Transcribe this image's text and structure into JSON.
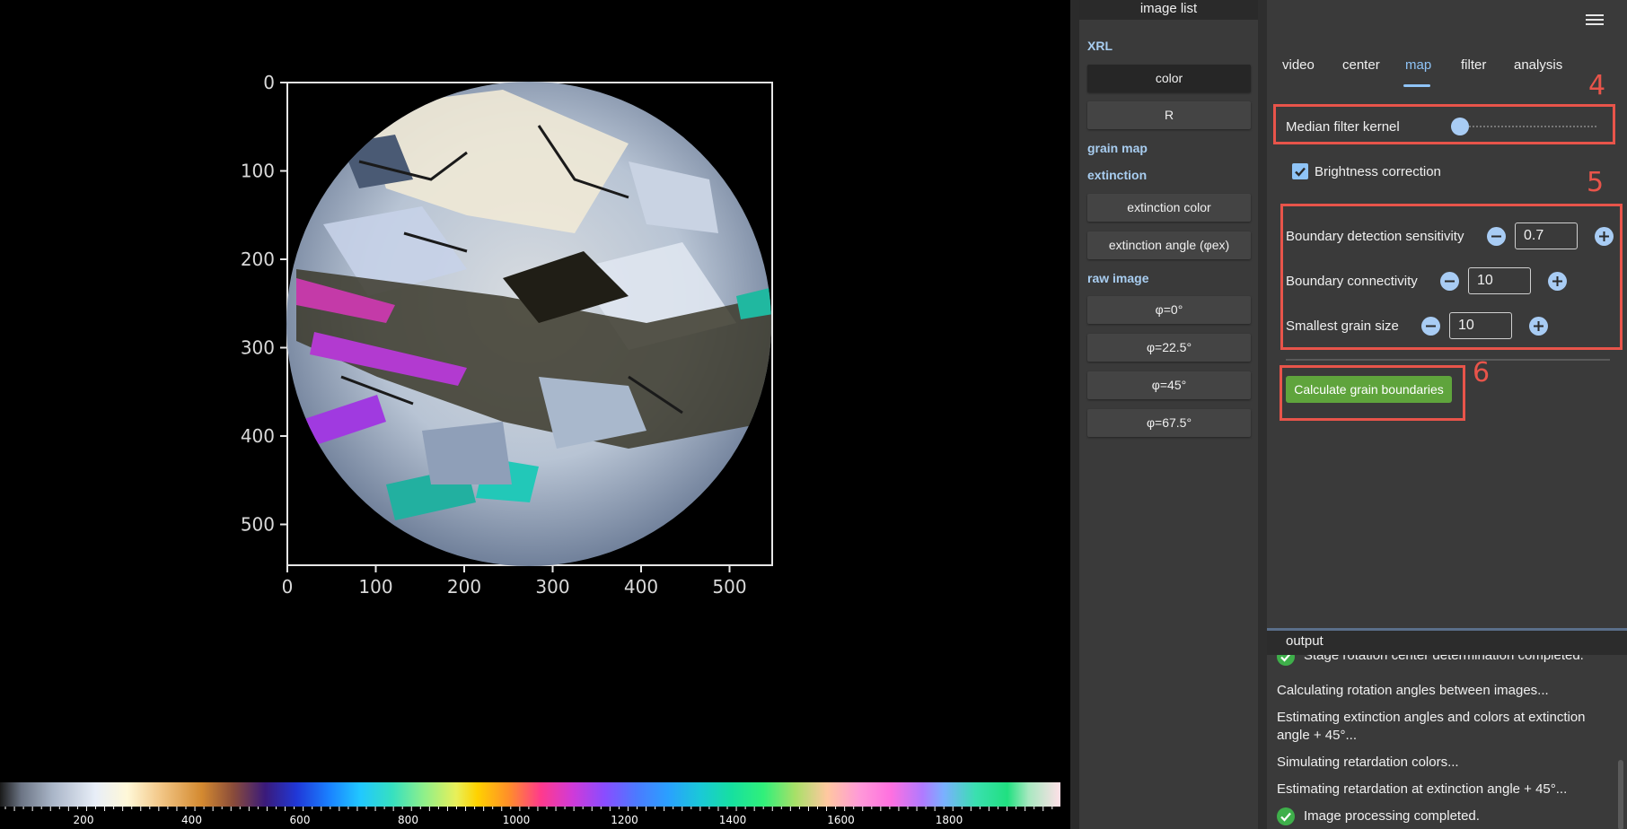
{
  "plot": {
    "x_ticks": [
      "0",
      "100",
      "200",
      "300",
      "400",
      "500"
    ],
    "y_ticks": [
      "0",
      "100",
      "200",
      "300",
      "400",
      "500"
    ],
    "colorbar_ticks": [
      "200",
      "400",
      "600",
      "800",
      "1000",
      "1200",
      "1400",
      "1600",
      "1800"
    ]
  },
  "image_list": {
    "header": "image list",
    "groups": {
      "xrl": "XRL",
      "grain_map": "grain map",
      "extinction": "extinction",
      "raw_image": "raw image"
    },
    "buttons": {
      "color": "color",
      "r": "R",
      "extinction_color": "extinction color",
      "extinction_angle": "extinction angle (φex)",
      "phi0": "φ=0°",
      "phi22": "φ=22.5°",
      "phi45": "φ=45°",
      "phi67": "φ=67.5°"
    },
    "selected": "color"
  },
  "settings": {
    "tabs": [
      "video",
      "center",
      "map",
      "filter",
      "analysis"
    ],
    "active_tab": "map",
    "median_filter_label": "Median filter kernel",
    "median_filter_level": 0,
    "brightness_label": "Brightness correction",
    "brightness_checked": true,
    "sensitivity_label": "Boundary detection sensitivity",
    "sensitivity_value": "0.7",
    "connectivity_label": "Boundary connectivity",
    "connectivity_value": "10",
    "grain_size_label": "Smallest grain size",
    "grain_size_value": "10",
    "calc_button": "Calculate grain boundaries",
    "annotations": [
      "4",
      "5",
      "6"
    ]
  },
  "output": {
    "header": "output",
    "lines": [
      "Stage rotation center determination completed.",
      "Calculating rotation angles between images...",
      "Estimating extinction angles and colors at extinction angle + 45°...",
      "Simulating retardation colors...",
      "Estimating retardation at extinction angle + 45°...",
      "Image processing completed."
    ]
  },
  "colors": {
    "accent": "#8fc4f7",
    "annotation": "#e8544a",
    "success": "#3eaf4a",
    "calc_button": "#5fa43c"
  }
}
